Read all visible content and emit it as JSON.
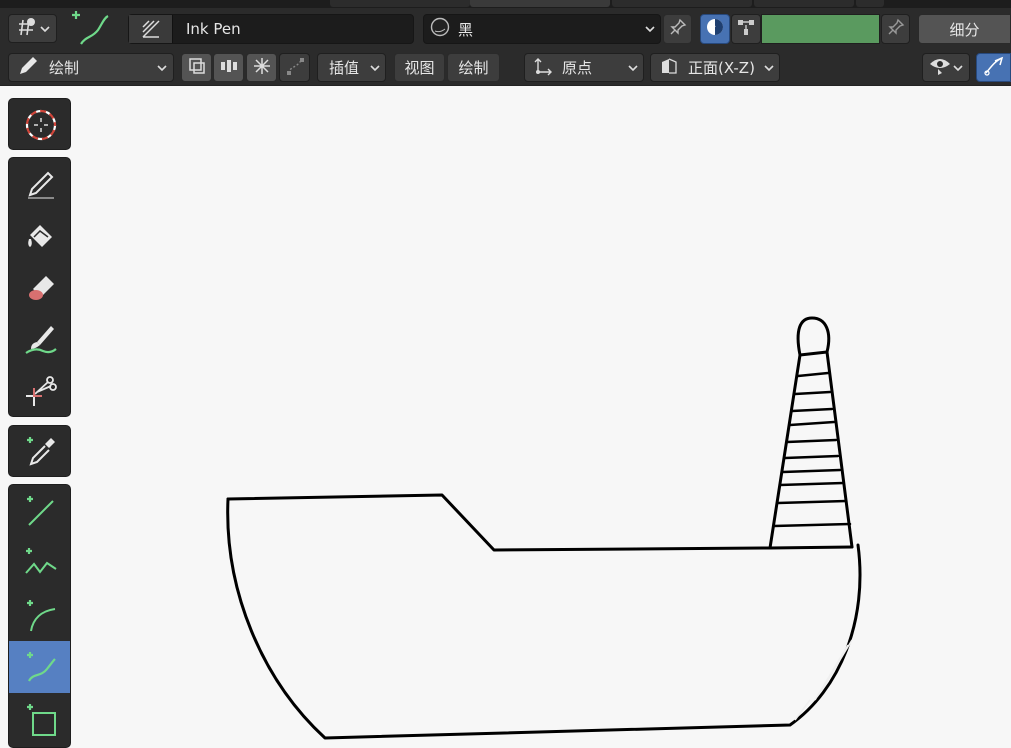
{
  "topbar": {
    "brush_name": "Ink Pen",
    "material_name": "黑",
    "subdivide_label": "细分",
    "color_swatch": "#5a9a5f",
    "icons": [
      "transform-orientation-icon",
      "stroke-curve-tool-icon",
      "brush-preview-icon",
      "material-sphere-icon",
      "pin-icon",
      "vertex-color-toggle-icon",
      "vertex-paint-mode-icon",
      "swatch-pin-icon"
    ]
  },
  "toolbar": {
    "mode_label": "绘制",
    "interpolate_label": "插值",
    "view_label": "视图",
    "draw_label": "绘制",
    "origin_label": "原点",
    "orientation_label": "正面(X-Z)",
    "icons": [
      "pencil-mode-icon",
      "layer-mask-icon",
      "multiframe-icon",
      "snowflake-icon",
      "curve-editing-icon",
      "origin-icon",
      "orientation-plane-icon",
      "overlay-eye-icon",
      "gizmo-curve-icon"
    ]
  },
  "tools": [
    {
      "name": "cursor-tool",
      "icon": "cursor-icon"
    },
    {
      "name": "draw-tool",
      "icon": "pencil-icon"
    },
    {
      "name": "fill-tool",
      "icon": "paint-bucket-icon"
    },
    {
      "name": "erase-tool",
      "icon": "eraser-icon"
    },
    {
      "name": "tint-tool",
      "icon": "brush-icon"
    },
    {
      "name": "cutter-tool",
      "icon": "scissors-icon"
    },
    {
      "name": "eyedropper-tool",
      "icon": "eyedropper-icon"
    },
    {
      "name": "line-tool",
      "icon": "line-icon"
    },
    {
      "name": "polyline-tool",
      "icon": "polyline-icon"
    },
    {
      "name": "arc-tool",
      "icon": "arc-icon"
    },
    {
      "name": "curve-tool",
      "icon": "curve-icon",
      "active": true
    },
    {
      "name": "box-tool",
      "icon": "box-icon"
    }
  ],
  "colors": {
    "header_bg": "#2b2b2b",
    "widget_bg": "#3d3d3d",
    "active_tool": "#5680c2",
    "accent_green": "#6fd98a",
    "canvas_bg": "#f7f7f7"
  }
}
